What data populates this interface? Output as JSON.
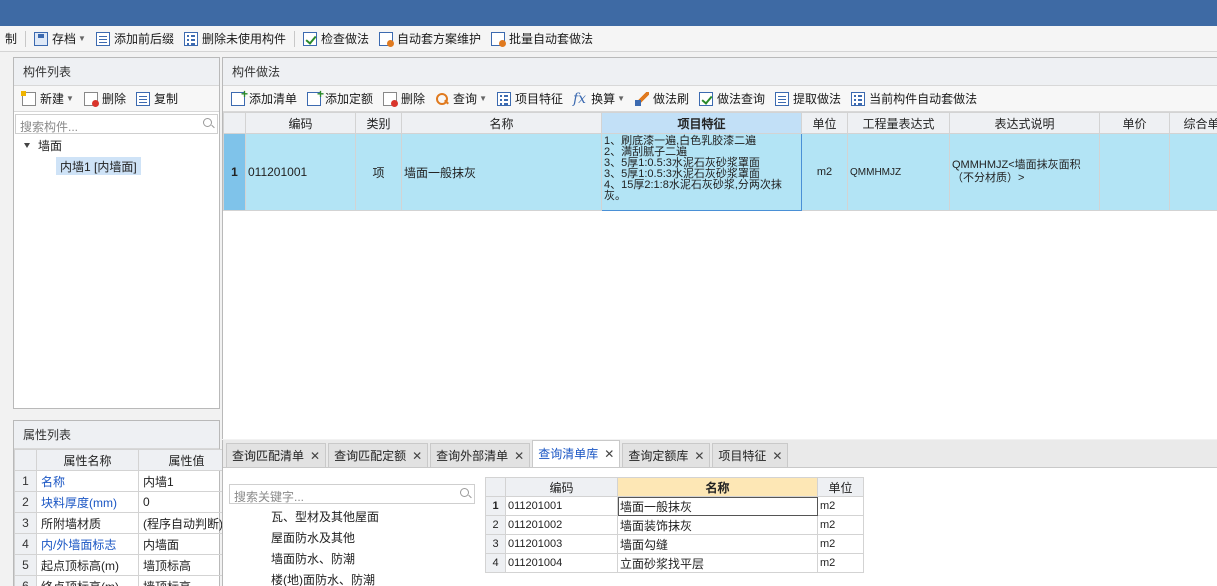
{
  "toolbar": {
    "items": [
      {
        "label": "制",
        "icon": ""
      },
      {
        "label": "存档",
        "icon": "save-icon"
      },
      {
        "label": "添加前后缀",
        "icon": "add-prefix-icon"
      },
      {
        "label": "删除未使用构件",
        "icon": "delete-unused-icon"
      },
      {
        "label": "检查做法",
        "icon": "check-method-icon"
      },
      {
        "label": "自动套方案维护",
        "icon": "auto-scheme-icon"
      },
      {
        "label": "批量自动套做法",
        "icon": "batch-auto-icon"
      }
    ]
  },
  "component_list": {
    "title": "构件列表",
    "new_label": "新建",
    "delete_label": "删除",
    "copy_label": "复制",
    "search_placeholder": "搜索构件...",
    "tree_root": "墙面",
    "tree_child": "内墙1 [内墙面]"
  },
  "property_list": {
    "title": "属性列表",
    "headers": [
      "属性名称",
      "属性值"
    ],
    "rows": [
      {
        "num": "1",
        "name": "名称",
        "value": "内墙1",
        "blue": true
      },
      {
        "num": "2",
        "name": "块料厚度(mm)",
        "value": "0",
        "blue": true
      },
      {
        "num": "3",
        "name": "所附墙材质",
        "value": "(程序自动判断)",
        "blue": false
      },
      {
        "num": "4",
        "name": "内/外墙面标志",
        "value": "内墙面",
        "blue": true
      },
      {
        "num": "5",
        "name": "起点顶标高(m)",
        "value": "墙顶标高",
        "blue": false
      },
      {
        "num": "6",
        "name": "终点顶标高(m)",
        "value": "墙顶标高",
        "blue": false
      }
    ]
  },
  "method": {
    "title": "构件做法",
    "toolbar": [
      "添加清单",
      "添加定额",
      "删除",
      "查询",
      "项目特征",
      "换算",
      "做法刷",
      "做法查询",
      "提取做法",
      "当前构件自动套做法"
    ],
    "headers": [
      "编码",
      "类别",
      "名称",
      "项目特征",
      "单位",
      "工程量表达式",
      "表达式说明",
      "单价",
      "综合单"
    ],
    "row": {
      "num": "1",
      "code": "011201001",
      "type": "项",
      "name": "墙面一般抹灰",
      "features": [
        "1、刷底漆一遍,白色乳胶漆二遍",
        "2、满刮腻子二遍",
        "3、5厚1:0.5:3水泥石灰砂浆罩面",
        "3、5厚1:0.5:3水泥石灰砂浆罩面",
        "4、15厚2:1:8水泥石灰砂浆,分两次抹灰。"
      ],
      "unit": "m2",
      "expr": "QMMHMJZ",
      "expr_desc": "QMMHMJZ<墙面抹灰面积（不分材质）>"
    }
  },
  "bottom_tabs": [
    "查询匹配清单",
    "查询匹配定额",
    "查询外部清单",
    "查询清单库",
    "查询定额库",
    "项目特征"
  ],
  "library": {
    "search_placeholder": "搜索关键字...",
    "tree_items": [
      "瓦、型材及其他屋面",
      "屋面防水及其他",
      "墙面防水、防潮",
      "楼(地)面防水、防潮"
    ],
    "headers": [
      "编码",
      "名称",
      "单位"
    ],
    "rows": [
      {
        "num": "1",
        "code": "011201001",
        "name": "墙面一般抹灰",
        "unit": "m2"
      },
      {
        "num": "2",
        "code": "011201002",
        "name": "墙面装饰抹灰",
        "unit": "m2"
      },
      {
        "num": "3",
        "code": "011201003",
        "name": "墙面勾缝",
        "unit": "m2"
      },
      {
        "num": "4",
        "code": "011201004",
        "name": "立面砂浆找平层",
        "unit": "m2"
      }
    ]
  }
}
